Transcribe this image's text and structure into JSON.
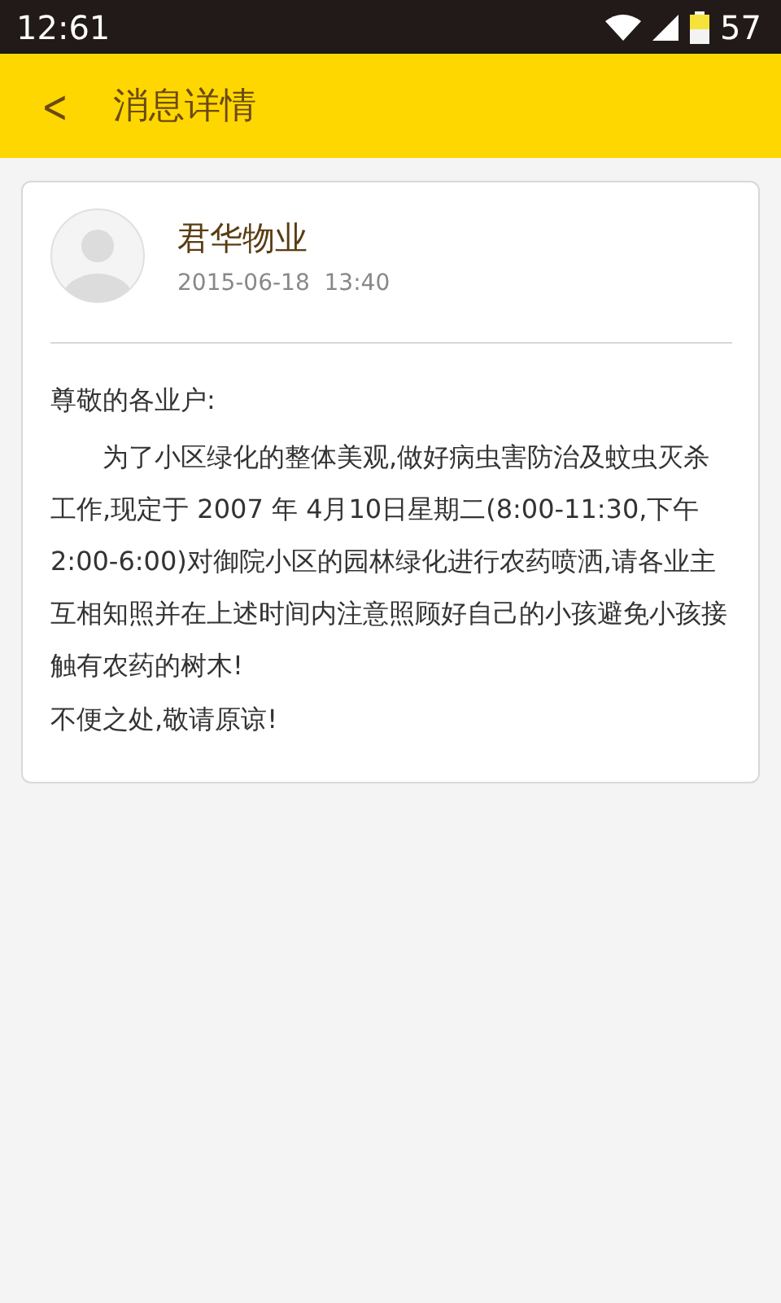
{
  "status_bar": {
    "time": "12:61",
    "battery": "57"
  },
  "header": {
    "back": "<",
    "title": "消息详情"
  },
  "message": {
    "sender": "君华物业",
    "datetime": "2015-06-18  13:40",
    "greeting": "尊敬的各业户:",
    "body": "为了小区绿化的整体美观,做好病虫害防治及蚊虫灭杀工作,现定于 2007 年 4月10日星期二(8:00-11:30,下午2:00-6:00)对御院小区的园林绿化进行农药喷洒,请各业主互相知照并在上述时间内注意照顾好自己的小孩避免小孩接触有农药的树木!",
    "closing": "不便之处,敬请原谅!"
  }
}
